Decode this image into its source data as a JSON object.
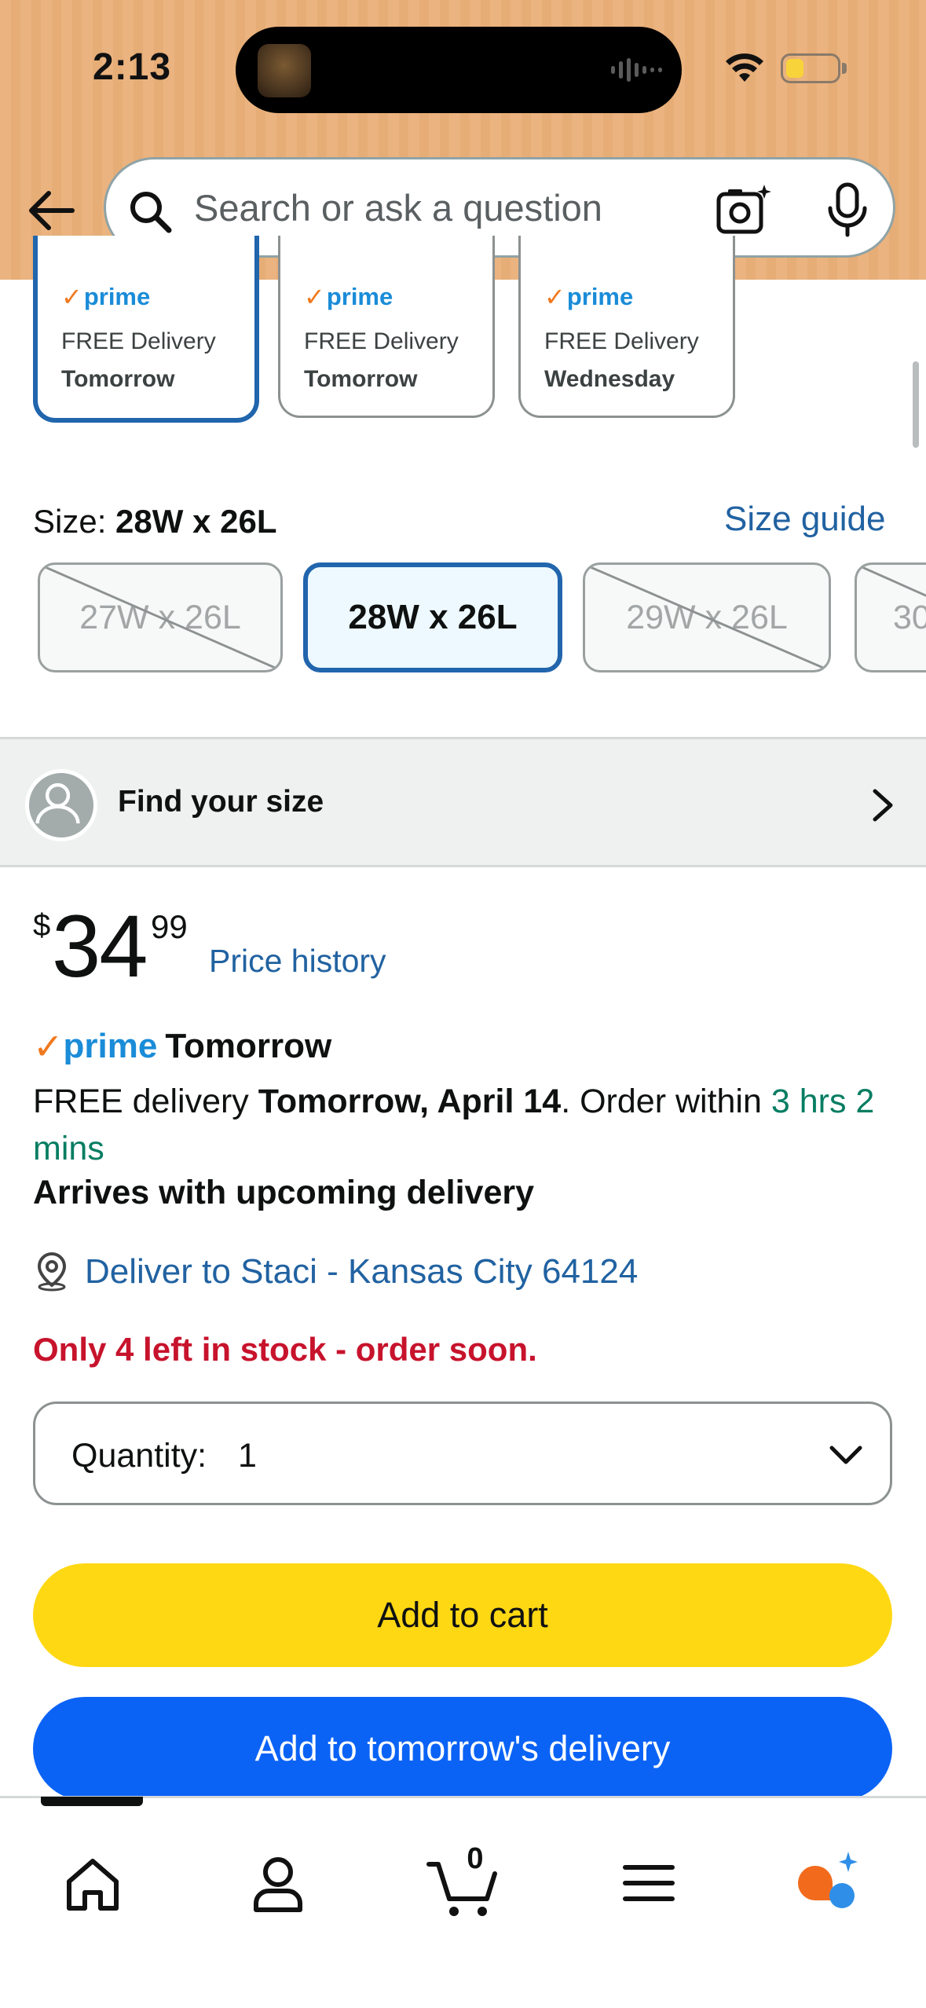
{
  "status_bar": {
    "time": "2:13"
  },
  "search": {
    "placeholder": "Search or ask a question"
  },
  "delivery_options": [
    {
      "prime_label": "prime",
      "line1": "FREE Delivery",
      "line2": "Tomorrow",
      "selected": true
    },
    {
      "prime_label": "prime",
      "line1": "FREE Delivery",
      "line2": "Tomorrow",
      "selected": false
    },
    {
      "prime_label": "prime",
      "line1": "FREE Delivery",
      "line2": "Wednesday",
      "selected": false
    }
  ],
  "size": {
    "label": "Size:",
    "selected": "28W x 26L",
    "guide_label": "Size guide",
    "options": [
      {
        "label": "27W x 26L",
        "available": false
      },
      {
        "label": "28W x 26L",
        "available": true,
        "selected": true
      },
      {
        "label": "29W x 26L",
        "available": false
      },
      {
        "label": "30",
        "available": false
      }
    ]
  },
  "find_size": {
    "label": "Find your size"
  },
  "price": {
    "symbol": "$",
    "whole": "34",
    "fraction": "99",
    "history_label": "Price history"
  },
  "prime_delivery": {
    "prime_word": "prime",
    "speed": "Tomorrow",
    "free_delivery_prefix": "FREE delivery ",
    "date": "Tomorrow, April 14",
    "order_within_prefix": ". Order within ",
    "countdown": "3 hrs 2 mins",
    "arrives_note": "Arrives with upcoming delivery"
  },
  "deliver_to": "Deliver to Staci - Kansas City 64124",
  "stock_message": "Only 4 left in stock - order soon.",
  "quantity": {
    "label": "Quantity:",
    "value": "1"
  },
  "buttons": {
    "add_to_cart": "Add to cart",
    "add_to_tomorrow": "Add to tomorrow's delivery"
  },
  "bottom_nav": {
    "cart_count": "0",
    "items": [
      "home-icon",
      "account-icon",
      "cart-icon",
      "menu-icon",
      "rufus-icon"
    ]
  },
  "colors": {
    "header_bg": "#ebb37f",
    "link_blue": "#2162a1",
    "selected_border": "#2165ad",
    "stock_red": "#c7132c",
    "countdown_green": "#067d62",
    "cart_yellow": "#ffd814",
    "tomorrow_blue": "#0b63f6",
    "prime_blue": "#1a8cd8",
    "prime_orange": "#f0791f"
  }
}
